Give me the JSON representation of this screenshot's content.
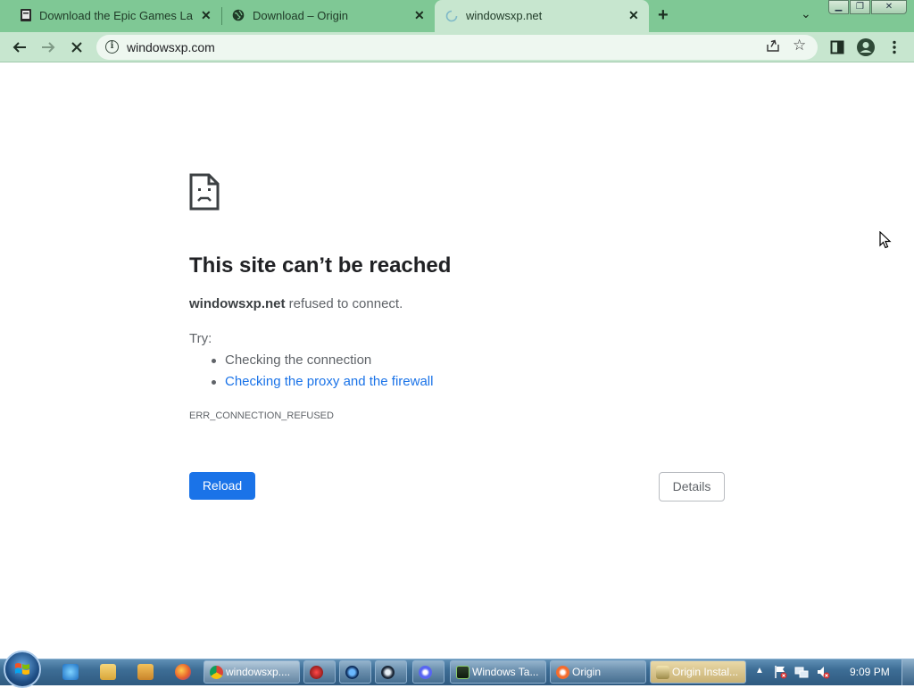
{
  "browser": {
    "tabs": [
      {
        "title": "Download the Epic Games Launc",
        "favicon": "epic-games-icon"
      },
      {
        "title": "Download – Origin",
        "favicon": "globe-icon"
      },
      {
        "title": "windowsxp.net",
        "favicon": "loading-spinner-icon",
        "active": true
      }
    ],
    "new_tab_icon": "plus-icon",
    "tab_search_icon": "chevron-down-icon",
    "window_controls": [
      "minimize-icon",
      "maximize-icon",
      "close-icon"
    ],
    "toolbar": {
      "back_icon": "arrow-left-icon",
      "forward_icon": "arrow-right-icon",
      "stop_icon": "close-icon",
      "site_info_icon": "info-icon",
      "url": "windowsxp.com",
      "share_icon": "share-icon",
      "bookmark_icon": "star-icon",
      "side_panel_icon": "side-panel-icon",
      "profile_icon": "avatar-icon",
      "menu_icon": "kebab-menu-icon"
    },
    "accent_color": "#7fc895"
  },
  "error_page": {
    "icon": "sad-page-icon",
    "title": "This site can’t be reached",
    "host": "windowsxp.net",
    "message": " refused to connect.",
    "try_label": "Try:",
    "suggestions": [
      "Checking the connection",
      "Checking the proxy and the firewall"
    ],
    "error_code": "ERR_CONNECTION_REFUSED",
    "reload_label": "Reload",
    "details_label": "Details",
    "link_color": "#1a73e8"
  },
  "taskbar": {
    "start_icon": "windows-start-orb-icon",
    "pinned": [
      "internet-explorer-icon",
      "file-explorer-icon",
      "media-player-icon",
      "firefox-icon"
    ],
    "tasks": [
      {
        "label": "windowsxp....",
        "icon": "chrome-icon",
        "active": true
      },
      {
        "label": "",
        "icon": "red-circle-app-icon"
      },
      {
        "label": "",
        "icon": "blue-c-app-icon"
      },
      {
        "label": "",
        "icon": "steam-icon"
      },
      {
        "label": "",
        "icon": "discord-icon"
      },
      {
        "label": "Windows Ta...",
        "icon": "task-manager-icon"
      },
      {
        "label": "Origin",
        "icon": "origin-icon"
      },
      {
        "label": "Origin Instal...",
        "icon": "installer-icon"
      }
    ],
    "tray_icons": [
      "flag-icon",
      "network-icon",
      "volume-muted-icon"
    ],
    "clock": "9:09 PM"
  }
}
